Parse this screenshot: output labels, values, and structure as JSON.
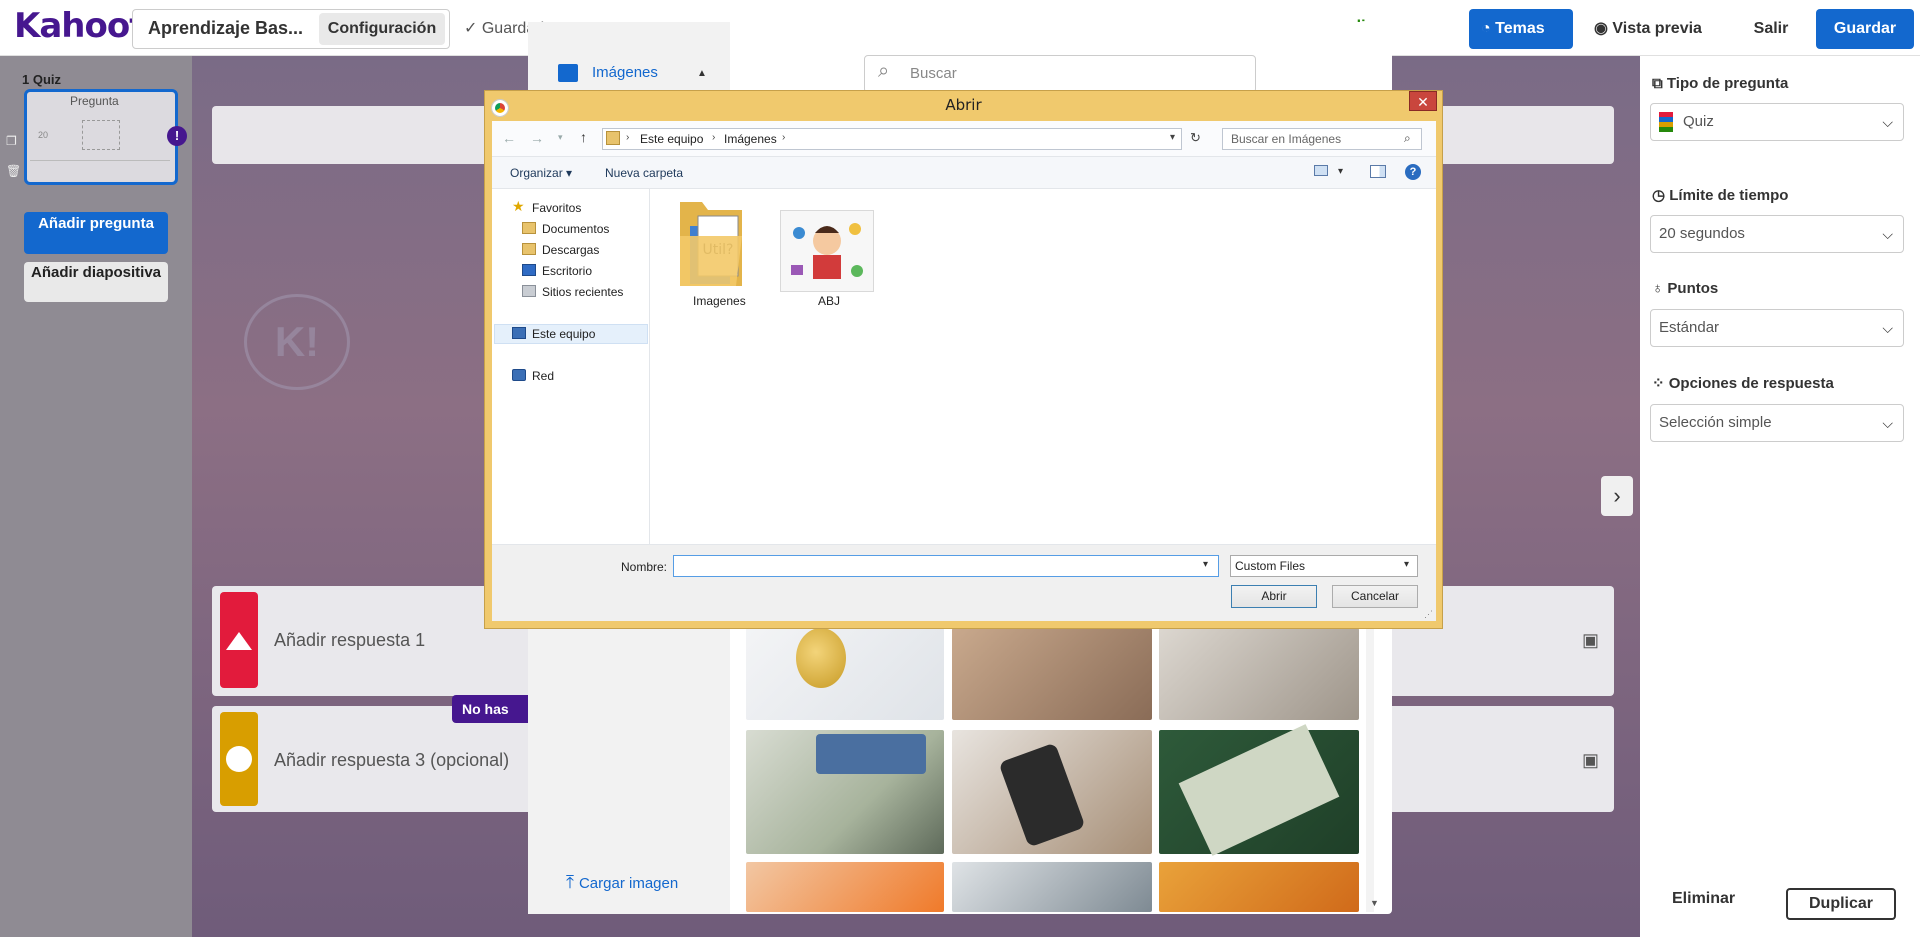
{
  "app": {
    "logo": "Kahoot!"
  },
  "header": {
    "title": "Aprendizaje Bas...",
    "settings_label": "Configuración",
    "saved_label": "✓  Guardado",
    "update_label": "ualizar",
    "themes_label": "Temas",
    "preview_label": "Vista previa",
    "exit_label": "Salir",
    "save_label": "Guardar"
  },
  "sidebar": {
    "question_number": "1",
    "question_type": "Quiz",
    "card_title": "Pregunta",
    "card_timer": "20",
    "warning": "!",
    "add_question": "Añadir pregunta",
    "add_slide": "Añadir diapositiva"
  },
  "canvas": {
    "answer1_placeholder": "Añadir respuesta 1",
    "answer3_placeholder": "Añadir respuesta 3 (opcional)",
    "tooltip": "No has añadido",
    "colors": {
      "red": "#e21b3c",
      "yellow": "#d89e00",
      "purple": "#46178f",
      "blue": "#1368ce"
    }
  },
  "right_panel": {
    "question_type": {
      "label": "Tipo de pregunta",
      "value": "Quiz"
    },
    "time_limit": {
      "label": "Límite de tiempo",
      "value": "20 segundos"
    },
    "points": {
      "label": "Puntos",
      "value": "Estándar"
    },
    "answer_options": {
      "label": "Opciones de respuesta",
      "value": "Selección simple"
    },
    "delete_label": "Eliminar",
    "duplicate_label": "Duplicar"
  },
  "image_library": {
    "tab_label": "Imágenes",
    "search_placeholder": "Buscar",
    "upload_label": "Cargar imagen"
  },
  "file_dialog": {
    "title": "Abrir",
    "path": [
      "Este equipo",
      "Imágenes"
    ],
    "search_placeholder": "Buscar en Imágenes",
    "organize_label": "Organizar ▾",
    "new_folder_label": "Nueva carpeta",
    "tree": {
      "favorites": "Favoritos",
      "documents": "Documentos",
      "downloads": "Descargas",
      "desktop": "Escritorio",
      "recent": "Sitios recientes",
      "this_pc": "Este equipo",
      "network": "Red"
    },
    "files": [
      {
        "name": "Imagenes",
        "kind": "folder"
      },
      {
        "name": "ABJ",
        "kind": "image"
      }
    ],
    "name_label": "Nombre:",
    "name_value": "",
    "file_type": "Custom Files",
    "open_label": "Abrir",
    "cancel_label": "Cancelar"
  }
}
